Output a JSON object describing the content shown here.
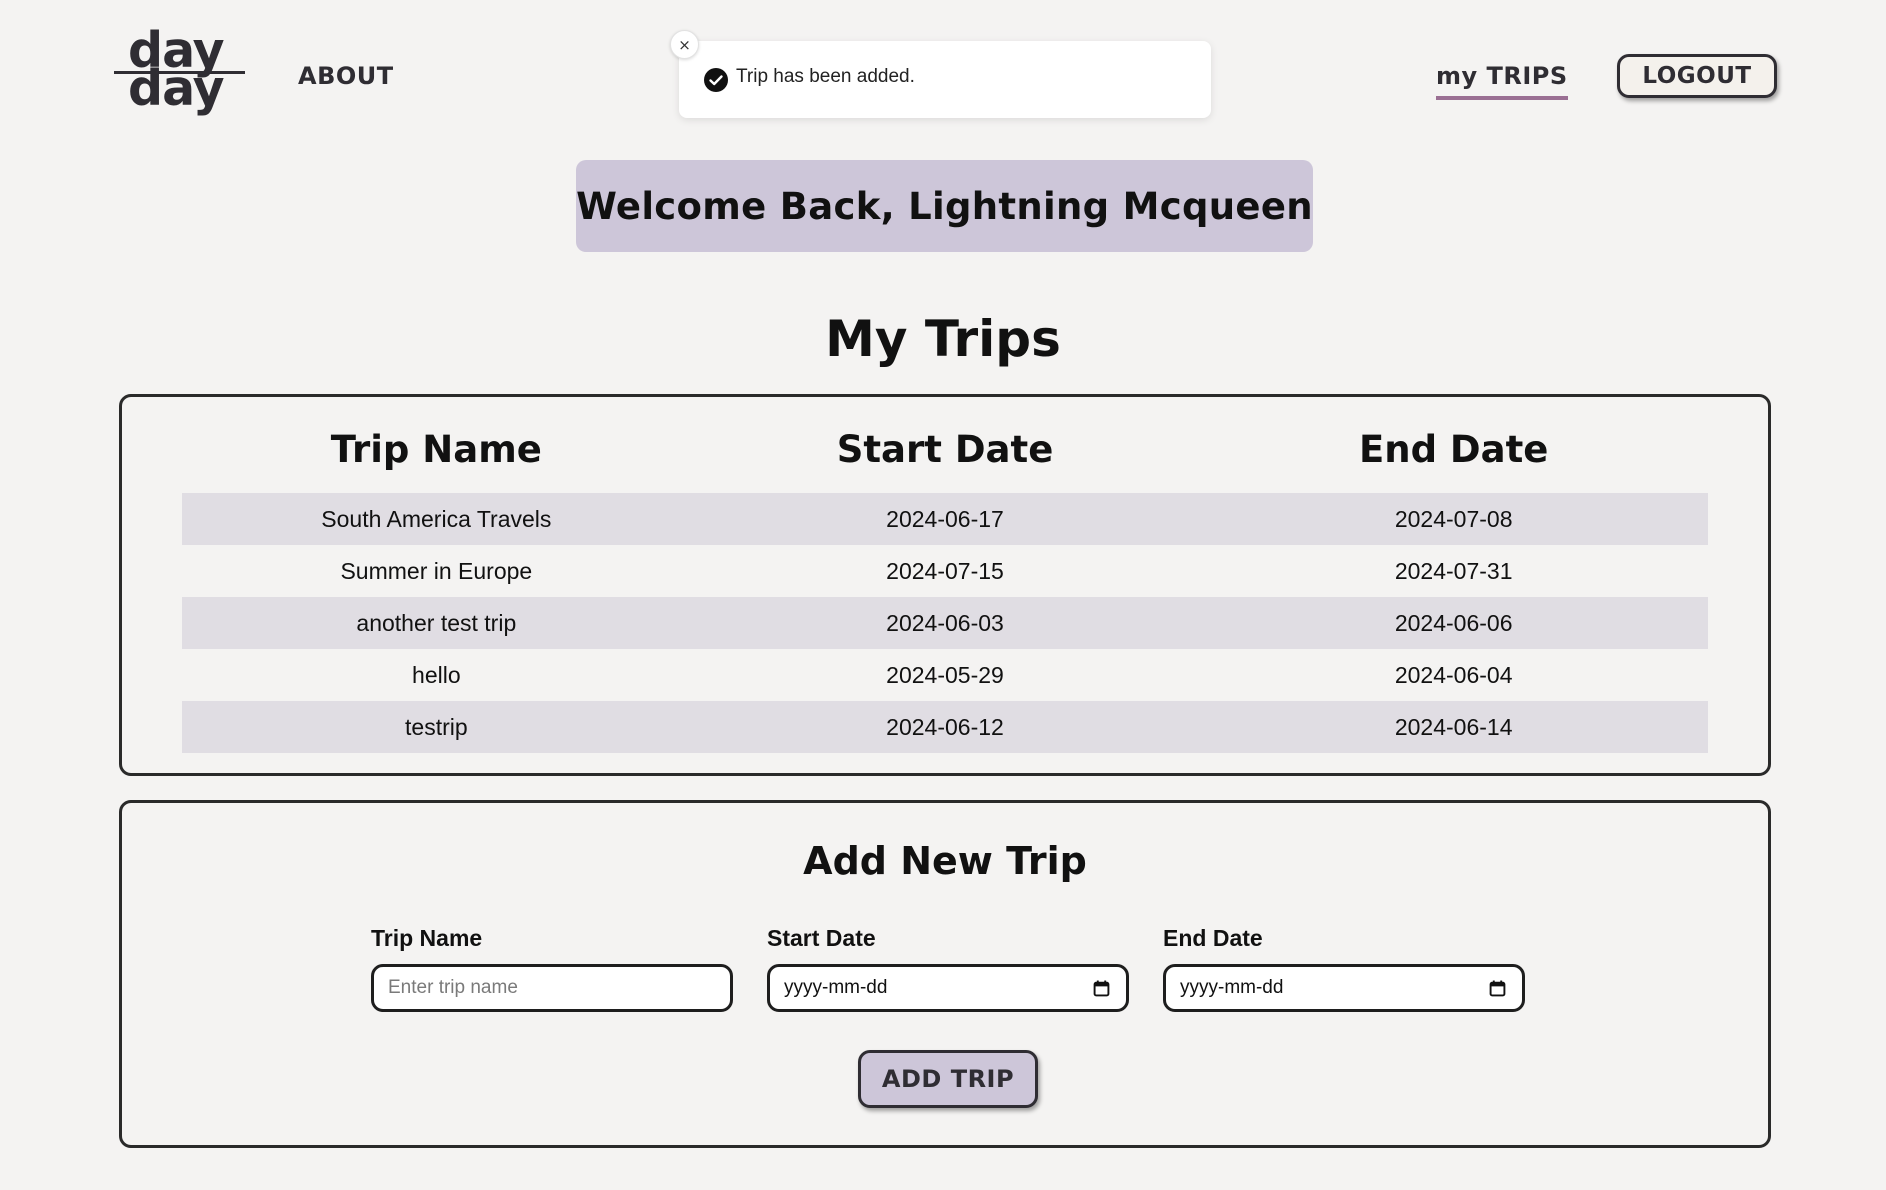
{
  "header": {
    "logo_top": "day",
    "logo_bottom": "day",
    "about_label": "ABOUT",
    "my_trips_label": "my TRIPS",
    "logout_label": "LOGOUT"
  },
  "toast": {
    "message": "Trip has been added.",
    "close_glyph": "×"
  },
  "welcome": {
    "text": "Welcome Back, Lightning Mcqueen"
  },
  "trips": {
    "title": "My Trips",
    "columns": [
      "Trip Name",
      "Start Date",
      "End Date"
    ],
    "rows": [
      [
        "South America Travels",
        "2024-06-17",
        "2024-07-08"
      ],
      [
        "Summer in Europe",
        "2024-07-15",
        "2024-07-31"
      ],
      [
        "another test trip",
        "2024-06-03",
        "2024-06-06"
      ],
      [
        "hello",
        "2024-05-29",
        "2024-06-04"
      ],
      [
        "testrip",
        "2024-06-12",
        "2024-06-14"
      ]
    ]
  },
  "add_trip": {
    "title": "Add New Trip",
    "trip_name_label": "Trip Name",
    "trip_name_placeholder": "Enter trip name",
    "start_date_label": "Start Date",
    "start_date_value": "yyyy-mm-dd",
    "end_date_label": "End Date",
    "end_date_value": "yyyy-mm-dd",
    "submit_label": "ADD TRIP"
  },
  "colors": {
    "background": "#f4f3f2",
    "accent_lavender": "#cdc6d9",
    "row_shade": "#e0dde3",
    "active_underline": "#9a6f93",
    "text_dark": "#2f2d33"
  },
  "icons": {
    "toast": "check-circle-icon",
    "close": "close-icon",
    "date": "calendar-icon"
  }
}
